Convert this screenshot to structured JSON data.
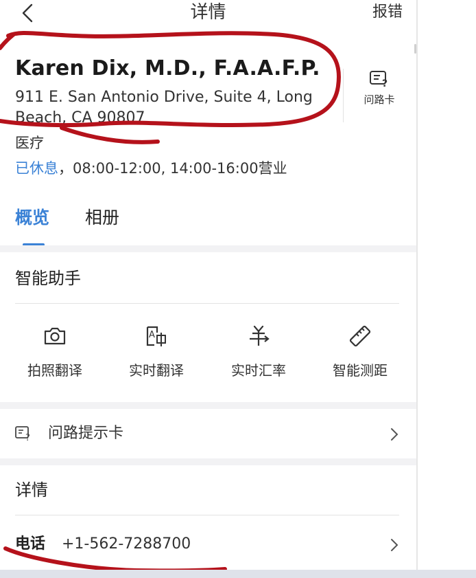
{
  "topbar": {
    "title": "详情",
    "report": "报错"
  },
  "place": {
    "name": "Karen Dix, M.D., F.A.A.F.P.",
    "address": "911 E. San Antonio Drive, Suite 4, Long Beach, CA 90807",
    "category": "医疗",
    "hours_status": "已休息",
    "hours_separator": "，",
    "hours_times": "08:00-12:00, 14:00-16:00营业",
    "ask_card_label": "问路卡"
  },
  "tabs": [
    {
      "label": "概览",
      "active": true
    },
    {
      "label": "相册",
      "active": false
    }
  ],
  "assistant": {
    "title": "智能助手",
    "tools": [
      {
        "label": "拍照翻译",
        "icon": "camera-icon"
      },
      {
        "label": "实时翻译",
        "icon": "translate-icon"
      },
      {
        "label": "实时汇率",
        "icon": "currency-icon"
      },
      {
        "label": "智能测距",
        "icon": "ruler-icon"
      }
    ]
  },
  "ask_tips_row": {
    "label": "问路提示卡",
    "icon": "ask-card-icon"
  },
  "details": {
    "title": "详情",
    "phone_label": "电话",
    "phone_value": "+1-562-7288700"
  },
  "colors": {
    "accent": "#3b82d6",
    "annotation": "#b5121b",
    "section_gap": "#f2f2f4"
  }
}
